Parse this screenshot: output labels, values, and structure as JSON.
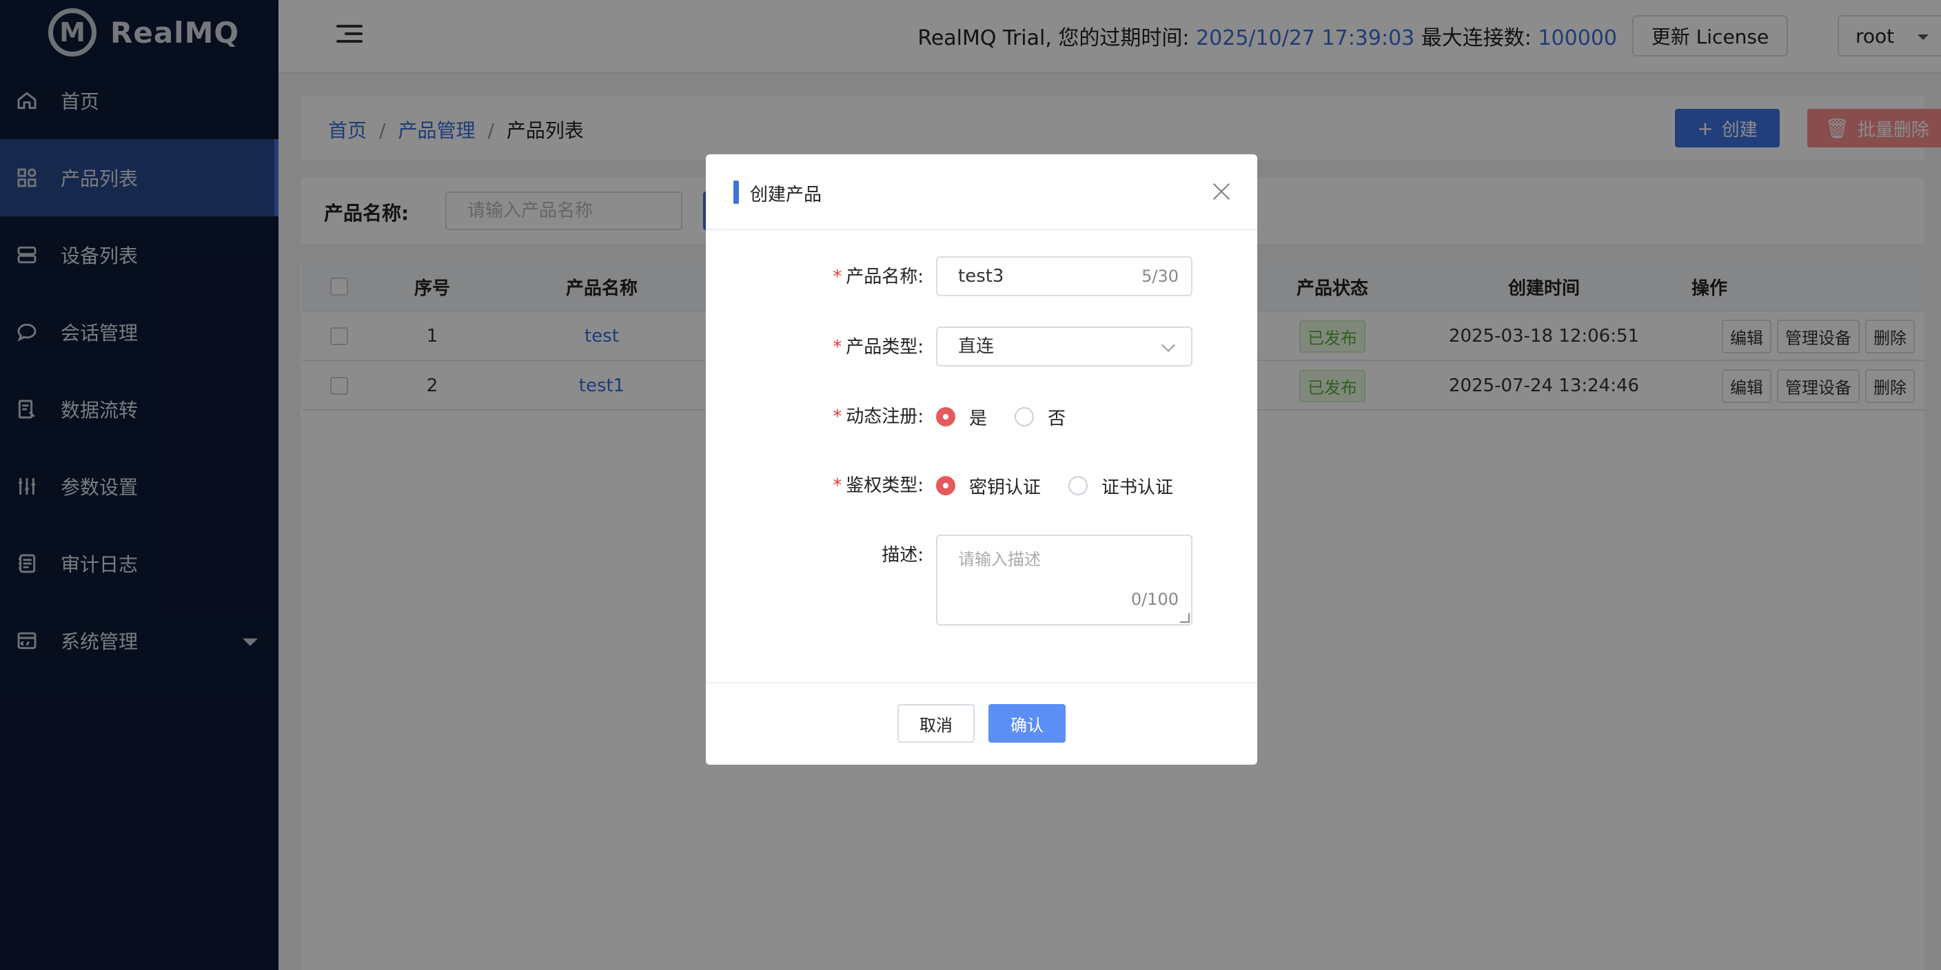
{
  "brand": {
    "name": "RealMQ",
    "mark": "M"
  },
  "sidebar": {
    "items": [
      {
        "label": "首页",
        "icon": "home-icon"
      },
      {
        "label": "产品列表",
        "icon": "apps-icon",
        "active": true
      },
      {
        "label": "设备列表",
        "icon": "server-icon"
      },
      {
        "label": "会话管理",
        "icon": "chat-icon"
      },
      {
        "label": "数据流转",
        "icon": "data-flow-icon"
      },
      {
        "label": "参数设置",
        "icon": "sliders-icon"
      },
      {
        "label": "审计日志",
        "icon": "log-icon"
      },
      {
        "label": "系统管理",
        "icon": "system-icon",
        "expandable": true
      }
    ]
  },
  "header": {
    "trial_prefix": "RealMQ Trial, 您的过期时间:",
    "expire_time": "2025/10/27 17:39:03",
    "max_conn_label": "最大连接数:",
    "max_conn": "100000",
    "license_button": "更新 License",
    "user": "root"
  },
  "breadcrumb": {
    "home": "首页",
    "section": "产品管理",
    "current": "产品列表",
    "separator": "/"
  },
  "actions": {
    "create": "创建",
    "create_icon": "+",
    "batch_delete": "批量删除",
    "batch_delete_icon": "🗑"
  },
  "filter": {
    "label": "产品名称:",
    "placeholder": "请输入产品名称"
  },
  "table": {
    "headers": {
      "seq": "序号",
      "name": "产品名称",
      "status": "产品状态",
      "created": "创建时间",
      "ops": "操作"
    },
    "rows": [
      {
        "seq": "1",
        "name": "test",
        "status": "已发布",
        "created": "2025-03-18 12:06:51"
      },
      {
        "seq": "2",
        "name": "test1",
        "status": "已发布",
        "created": "2025-07-24 13:24:46"
      }
    ],
    "ops": {
      "edit": "编辑",
      "manage": "管理设备",
      "delete": "删除"
    }
  },
  "modal": {
    "title": "创建产品",
    "fields": {
      "name": {
        "label": "产品名称:",
        "value": "test3",
        "count": "5/30"
      },
      "type": {
        "label": "产品类型:",
        "value": "直连"
      },
      "dynamic": {
        "label": "动态注册:",
        "options": [
          "是",
          "否"
        ],
        "selected": "是"
      },
      "auth": {
        "label": "鉴权类型:",
        "options": [
          "密钥认证",
          "证书认证"
        ],
        "selected": "密钥认证"
      },
      "desc": {
        "label": "描述:",
        "placeholder": "请输入描述",
        "count": "0/100"
      }
    },
    "required_mark": "*",
    "cancel": "取消",
    "confirm": "确认"
  },
  "colors": {
    "sidebar_bg": "#0e1a35",
    "accent": "#3f73e0",
    "danger": "#e8595c",
    "published": "#5bae3a"
  }
}
